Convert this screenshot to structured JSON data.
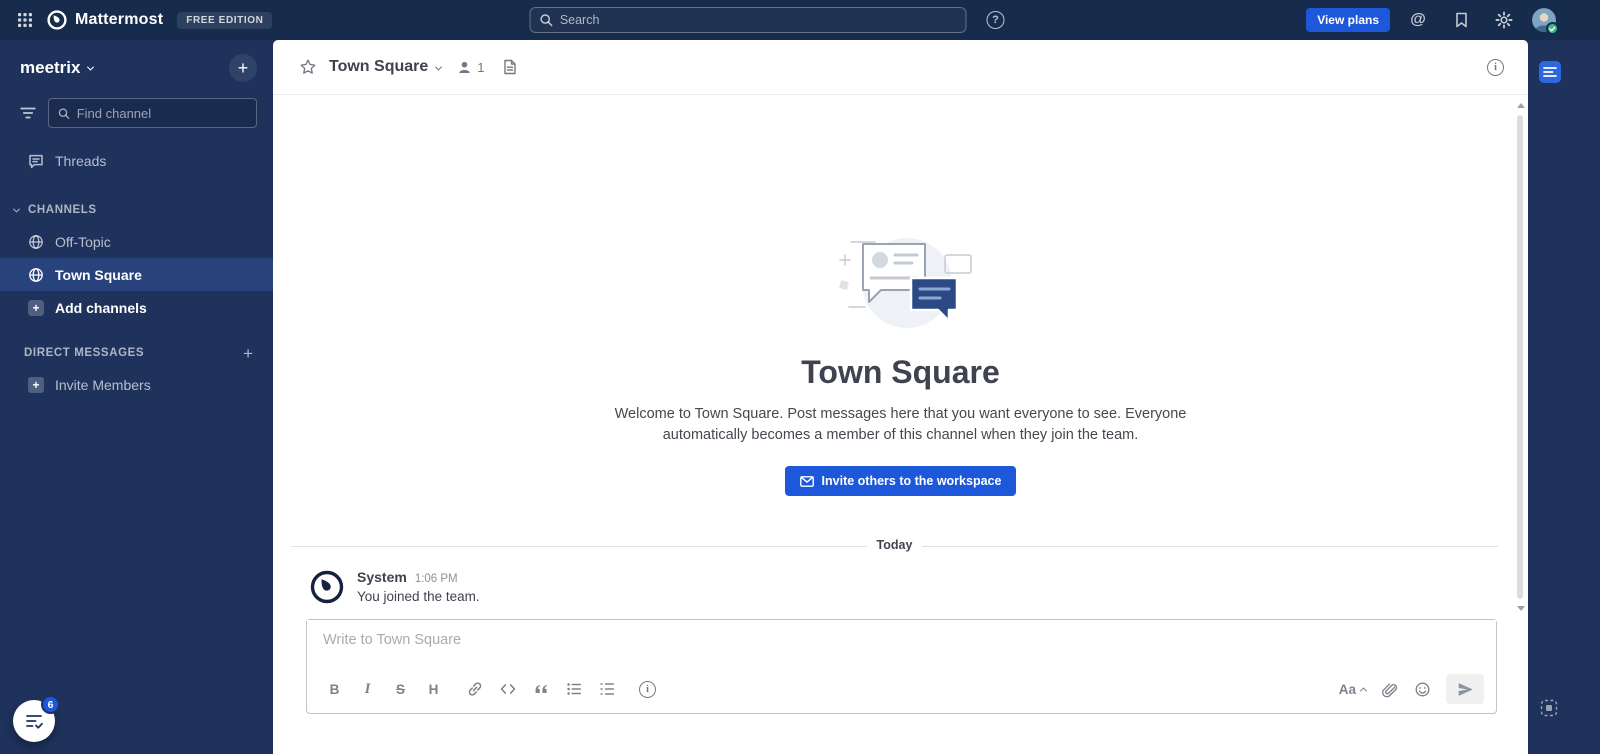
{
  "colors": {
    "topbar_bg": "#172b4d",
    "sidebar_bg": "#1e325c",
    "selected_channel_bg": "#28427b",
    "accent_blue": "#1c58d9",
    "text_dark": "#3f4350",
    "muted_gray": "#8f9098",
    "online_green": "#3db887"
  },
  "icons": {
    "question": "?",
    "at": "@",
    "info": "i",
    "plus": "+"
  },
  "top_bar": {
    "product_name": "Mattermost",
    "edition_badge": "FREE EDITION",
    "search_placeholder": "Search",
    "view_plans_label": "View plans"
  },
  "sidebar": {
    "team_name": "meetrix",
    "find_channel_placeholder": "Find channel",
    "threads_label": "Threads",
    "channels_header": "CHANNELS",
    "channels": [
      {
        "name": "Off-Topic"
      },
      {
        "name": "Town Square"
      }
    ],
    "add_channels_label": "Add channels",
    "direct_messages_header": "DIRECT MESSAGES",
    "invite_members_label": "Invite Members",
    "checklist_badge": "6"
  },
  "channel_header": {
    "title": "Town Square",
    "member_count": "1"
  },
  "intro": {
    "title": "Town Square",
    "welcome_text": "Welcome to Town Square. Post messages here that you want everyone to see. Everyone automatically becomes a member of this channel when they join the team.",
    "invite_button_label": "Invite others to the workspace"
  },
  "messages": {
    "date_divider": "Today",
    "items": [
      {
        "sender": "System",
        "time": "1:06 PM",
        "text": "You joined the team."
      }
    ]
  },
  "composer": {
    "placeholder": "Write to Town Square",
    "bold": "B",
    "italic": "I",
    "strike": "S",
    "heading": "H",
    "aa_label": "Aa"
  }
}
